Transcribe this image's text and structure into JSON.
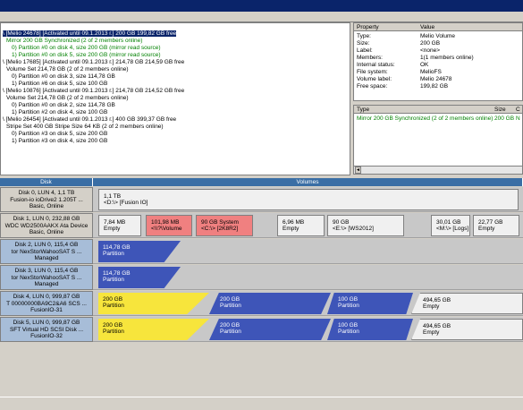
{
  "tree": {
    "lines": [
      {
        "text": "\\ [Melio 24678] [Activated until 09.1.2013 г.] 200 GB 199,82 GB free",
        "selected": true
      },
      {
        "text": "Mirror 200 GB Synchronized (2 of 2 members online)",
        "green": true
      },
      {
        "text": "0) Partition #0 on disk 4, size 200 GB (mirror read source)",
        "green": true
      },
      {
        "text": "1) Partition #0 on disk 5, size 200 GB (mirror read source)",
        "green": true
      },
      {
        "text": "\\ [Melio 17685] [Activated until 09.1.2013 г.] 214,78 GB 214,59 GB free"
      },
      {
        "text": "Volume Set 214,78 GB (2 of 2 members online)"
      },
      {
        "text": "0) Partition #0 on disk 3, size 114,78 GB"
      },
      {
        "text": "1) Partition #6 on disk 5, size 100 GB"
      },
      {
        "text": "\\ [Melio 10876] [Activated until 09.1.2013 г.] 214,78 GB 214,52 GB free"
      },
      {
        "text": "Volume Set 214,78 GB (2 of 2 members online)"
      },
      {
        "text": "0) Partition #0 on disk 2, size 114,78 GB"
      },
      {
        "text": "1) Partition #2 on disk 4, size 100 GB"
      },
      {
        "text": "\\ [Melio 26454] [Activated until 09.1.2013 г.] 400 GB 399,37 GB free"
      },
      {
        "text": "Stripe Set 400 GB Stripe Size 64 KB (2 of 2 members online)"
      },
      {
        "text": "0) Partition #3 on disk 5, size 200 GB"
      },
      {
        "text": "1) Partition #3 on disk 4, size 200 GB"
      }
    ]
  },
  "props": {
    "header": {
      "property": "Property",
      "value": "Value"
    },
    "rows": [
      {
        "k": "Type:",
        "v": "Melio Volume"
      },
      {
        "k": "Size:",
        "v": "200 GB"
      },
      {
        "k": "Label:",
        "v": "<none>"
      },
      {
        "k": "Members:",
        "v": "1(1 members online)"
      },
      {
        "k": "Internal status:",
        "v": "OK"
      },
      {
        "k": "File system:",
        "v": "MelioFS"
      },
      {
        "k": "Volume label:",
        "v": "Melio 24678"
      },
      {
        "k": "Free space:",
        "v": "199,82 GB"
      }
    ]
  },
  "typepane": {
    "header": {
      "type": "Type",
      "size": "Size",
      "c": "C"
    },
    "row": {
      "type": "Mirror 200 GB Synchronized (2 of 2 members online)",
      "size": "200 GB",
      "c": "N"
    },
    "arrow": "◄"
  },
  "disktable": {
    "header_disk": "Disk",
    "header_volumes": "Volumes",
    "rows": [
      {
        "l1": "Disk 0, LUN 4, 1,1 TB",
        "l2": "Fusion-io ioDrive2 1.205T ...",
        "l3": "Basic, Online"
      },
      {
        "l1": "Disk 1, LUN 0, 232,88 GB",
        "l2": "WDC WD2500AAKX Ata Device",
        "l3": "Basic, Online"
      },
      {
        "l1": "Disk 2, LUN 0, 115,4 GB",
        "l2": "tor  NexStorWahooSAT S ...",
        "l3": "Managed"
      },
      {
        "l1": "Disk 3, LUN 0, 115,4 GB",
        "l2": "tor  NexStorWahooSAT S ...",
        "l3": "Managed"
      },
      {
        "l1": "Disk 4, LUN 0, 999,87 GB",
        "l2": "T 00000000BA9C2&A6 SCS ...",
        "l3": "FusionIO-31"
      },
      {
        "l1": "Disk 5, LUN 0, 999,87 GB",
        "l2": "SFT Virtual HD SCSI Disk ...",
        "l3": "FusionIO-32"
      }
    ],
    "parts": {
      "d0": [
        {
          "a": "1,1 TB",
          "b": "<D:\\> [Fusion IO]"
        }
      ],
      "d1": [
        {
          "a": "7,84 MB",
          "b": "Empty"
        },
        {
          "a": "101,98 MB",
          "b": "<\\\\?\\Volume"
        },
        {
          "a": "90 GB System",
          "b": "<C:\\> [2K8R2]"
        },
        {
          "a": "6,96 MB",
          "b": "Empty"
        },
        {
          "a": "90 GB",
          "b": "<E:\\> [WS2012]"
        },
        {
          "a": "30,01 GB",
          "b": "<M:\\> [Logs]"
        },
        {
          "a": "22,77 GB",
          "b": "Empty"
        }
      ],
      "d2": [
        {
          "a": "114,78 GB",
          "b": "Partition"
        }
      ],
      "d3": [
        {
          "a": "114,78 GB",
          "b": "Partition"
        }
      ],
      "d4": [
        {
          "a": "200 GB",
          "b": "Partition"
        },
        {
          "a": "200 GB",
          "b": "Partition"
        },
        {
          "a": "100 GB",
          "b": "Partition"
        },
        {
          "a": "494,65 GB",
          "b": "Empty"
        }
      ],
      "d5": [
        {
          "a": "200 GB",
          "b": "Partition"
        },
        {
          "a": "200 GB",
          "b": "Partition"
        },
        {
          "a": "100 GB",
          "b": "Partition"
        },
        {
          "a": "494,65 GB",
          "b": "Empty"
        }
      ]
    }
  },
  "colors": {
    "title_bar": "#0a246a",
    "selection": "#0a246a",
    "header_blue": "#3a6ea5",
    "partition_blue": "#3e55b8",
    "partition_yellow": "#f7e53c",
    "partition_red": "#f08080",
    "green_text": "#008000"
  }
}
